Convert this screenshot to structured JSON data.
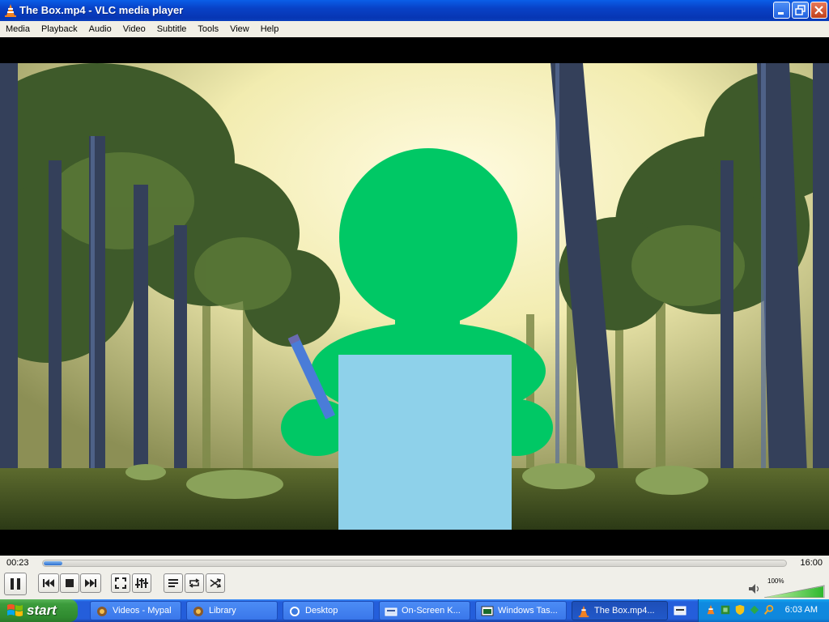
{
  "window": {
    "title": "The Box.mp4 - VLC media player",
    "icons": [
      "vlc-cone-icon",
      "minimize-icon",
      "maximize-icon",
      "close-icon"
    ]
  },
  "menu": [
    "Media",
    "Playback",
    "Audio",
    "Video",
    "Subtitle",
    "Tools",
    "View",
    "Help"
  ],
  "player": {
    "current_time": "00:23",
    "total_time": "16:00",
    "progress": 0.025,
    "volume_label": "100%",
    "volume": 1.0,
    "buttons": [
      "pause",
      "previous",
      "stop",
      "next",
      "fullscreen",
      "extended-settings",
      "playlist",
      "loop",
      "shuffle"
    ]
  },
  "taskbar": {
    "start_label": "start",
    "tasks": [
      {
        "label": "Videos - Mypal",
        "icon": "mypal-icon"
      },
      {
        "label": "Library",
        "icon": "library-icon"
      },
      {
        "label": "Desktop",
        "icon": "desktop-icon"
      },
      {
        "label": "On-Screen K...",
        "icon": "keyboard-icon"
      },
      {
        "label": "Windows Tas...",
        "icon": "task-manager-icon"
      },
      {
        "label": "The Box.mp4...",
        "icon": "vlc-cone-icon",
        "active": true
      }
    ],
    "clock": "6:03 AM",
    "colors": {
      "taskbar": "#245edb",
      "start": "#3c9c3c",
      "tray": "#0f8ae0"
    }
  },
  "video_colors": {
    "figure": "#00c865",
    "paper": "#8ed1ea",
    "sky": "#f5f0b8"
  }
}
